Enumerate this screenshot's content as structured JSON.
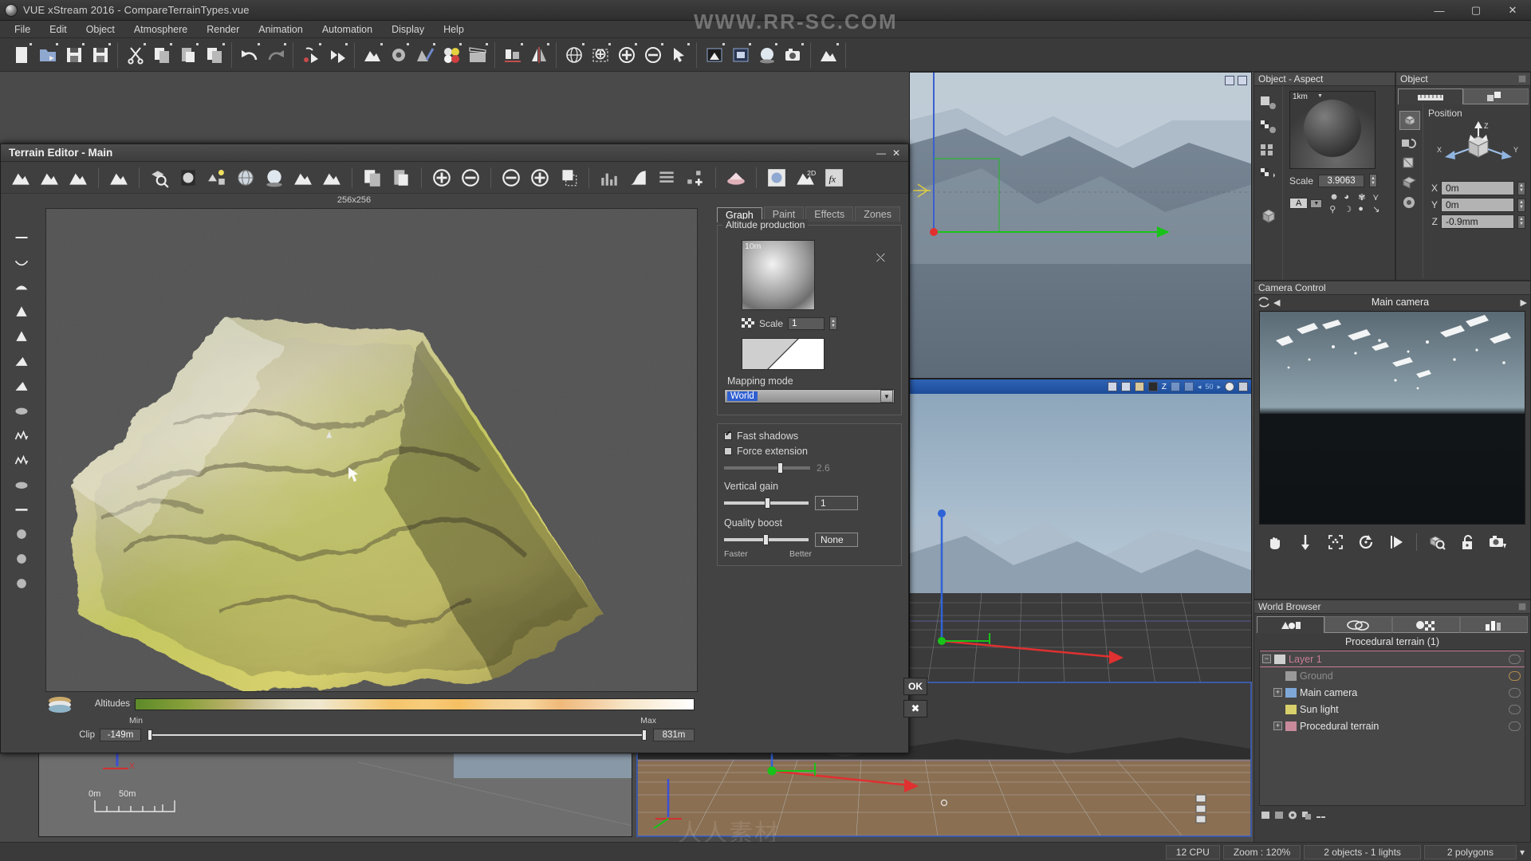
{
  "window": {
    "title": "VUE xStream 2016 - CompareTerrainTypes.vue",
    "minimize": "—",
    "maximize": "▢",
    "close": "✕",
    "logo_icon": "vue-app-icon"
  },
  "menu": [
    "File",
    "Edit",
    "Object",
    "Atmosphere",
    "Render",
    "Animation",
    "Automation",
    "Display",
    "Help"
  ],
  "toolbar": {
    "groups": [
      {
        "name": "file",
        "buttons": [
          {
            "icon": "new-document-icon",
            "label": "New"
          },
          {
            "icon": "open-folder-icon",
            "label": "Open"
          },
          {
            "icon": "save-icon",
            "label": "Save"
          },
          {
            "icon": "quick-save-icon",
            "label": "Quick save"
          }
        ]
      },
      {
        "name": "clipboard",
        "buttons": [
          {
            "icon": "scissors-icon",
            "label": "Cut"
          },
          {
            "icon": "copy-icon",
            "label": "Copy"
          },
          {
            "icon": "paste-icon",
            "label": "Paste"
          },
          {
            "icon": "duplicate-icon",
            "label": "Duplicate"
          }
        ]
      },
      {
        "name": "history",
        "buttons": [
          {
            "icon": "undo-arrow-icon",
            "label": "Undo"
          },
          {
            "icon": "redo-arrow-icon",
            "label": "Redo"
          }
        ]
      },
      {
        "name": "record",
        "buttons": [
          {
            "icon": "record-cursor-icon",
            "label": "Record"
          },
          {
            "icon": "play-cursor-icon",
            "label": "Play"
          }
        ]
      },
      {
        "name": "create",
        "buttons": [
          {
            "icon": "terrain-icon",
            "label": "Create terrain"
          },
          {
            "icon": "object-gear-icon",
            "label": "Object properties"
          },
          {
            "icon": "material-brush-icon",
            "label": "Material editor"
          },
          {
            "icon": "color-spheres-icon",
            "label": "Colors"
          },
          {
            "icon": "clapperboard-icon",
            "label": "Animation"
          }
        ]
      },
      {
        "name": "align",
        "buttons": [
          {
            "icon": "align-bar-icon",
            "label": "Align"
          },
          {
            "icon": "mirror-icon",
            "label": "Mirror"
          }
        ]
      },
      {
        "name": "view",
        "buttons": [
          {
            "icon": "globe-icon",
            "label": "Globe"
          },
          {
            "icon": "zoom-region-icon",
            "label": "Zoom region"
          },
          {
            "icon": "zoom-in-icon",
            "label": "Zoom in"
          },
          {
            "icon": "zoom-out-icon",
            "label": "Zoom out"
          },
          {
            "icon": "select-pointer-icon",
            "label": "Select"
          }
        ]
      },
      {
        "name": "render",
        "buttons": [
          {
            "icon": "render-preview-icon",
            "label": "Render preview"
          },
          {
            "icon": "render-area-icon",
            "label": "Render area"
          },
          {
            "icon": "render-sphere-icon",
            "label": "Render object"
          },
          {
            "icon": "camera-icon",
            "label": "Camera"
          }
        ]
      },
      {
        "name": "export",
        "buttons": [
          {
            "icon": "export-terrain-icon",
            "label": "Export"
          }
        ]
      }
    ]
  },
  "terrain_editor": {
    "title": "Terrain Editor - Main",
    "title_buttons": {
      "minimize": "—",
      "close": "✕"
    },
    "resolution_label": "256x256",
    "toolbar": [
      {
        "icon": "new-terrain-icon",
        "label": "New terrain"
      },
      {
        "icon": "load-terrain-icon",
        "label": "Load terrain"
      },
      {
        "icon": "save-terrain-icon",
        "label": "Save terrain"
      },
      {
        "icon": "terrain-options-icon",
        "label": "Terrain options"
      },
      {
        "icon": "zoom-cube-icon",
        "label": "Zoom"
      },
      {
        "icon": "light-preview-icon",
        "label": "Lighting preview"
      },
      {
        "icon": "scene-preview-icon",
        "label": "Scene preview"
      },
      {
        "icon": "sphere-wire-icon",
        "label": "Wireframe sphere"
      },
      {
        "icon": "sphere-smooth-icon",
        "label": "Smooth sphere"
      },
      {
        "icon": "sphere-terrain-icon",
        "label": "Terrain sphere"
      },
      {
        "icon": "terrain-flat-icon",
        "label": "Flat terrain"
      },
      {
        "icon": "copy-layers-icon",
        "label": "Copy"
      },
      {
        "icon": "paste-layers-icon",
        "label": "Paste"
      },
      {
        "icon": "add-circle-icon",
        "label": "Add"
      },
      {
        "icon": "remove-circle-icon",
        "label": "Remove"
      },
      {
        "icon": "decrease-resolution-icon",
        "label": "Decrease resolution"
      },
      {
        "icon": "increase-resolution-icon",
        "label": "Increase resolution"
      },
      {
        "icon": "crop-icon",
        "label": "Crop"
      },
      {
        "icon": "histogram-icon",
        "label": "Histogram"
      },
      {
        "icon": "curve-icon",
        "label": "Curve"
      },
      {
        "icon": "layers-icon",
        "label": "Layers"
      },
      {
        "icon": "add-node-icon",
        "label": "Add node"
      },
      {
        "icon": "erosion-icon",
        "label": "Erosion"
      },
      {
        "icon": "fullscreen-preview-icon",
        "label": "Fullscreen preview"
      },
      {
        "icon": "terrain-2d-icon",
        "label": "2D view"
      },
      {
        "icon": "effects-fx-icon",
        "label": "Effects"
      }
    ],
    "rail": [
      {
        "icon": "line-tool-icon",
        "label": "Line"
      },
      {
        "icon": "dig-tool-icon",
        "label": "Dig"
      },
      {
        "icon": "raise-tool-icon",
        "label": "Raise"
      },
      {
        "icon": "peak-tool-icon",
        "label": "Peak"
      },
      {
        "icon": "cone-tool-icon",
        "label": "Cone"
      },
      {
        "icon": "ridge-tool-icon",
        "label": "Ridge"
      },
      {
        "icon": "slope-tool-icon",
        "label": "Slope"
      },
      {
        "icon": "smooth-tool-icon",
        "label": "Smooth"
      },
      {
        "icon": "erode-tool-icon",
        "label": "Erode"
      },
      {
        "icon": "noise-tool-icon",
        "label": "Noise"
      },
      {
        "icon": "blur-tool-icon",
        "label": "Blur"
      },
      {
        "icon": "level-tool-icon",
        "label": "Level"
      },
      {
        "icon": "stamp-tool-icon",
        "label": "Stamp"
      },
      {
        "icon": "mask-tool-icon",
        "label": "Mask"
      },
      {
        "icon": "paint-tool-icon",
        "label": "Paint"
      }
    ],
    "tabs": [
      {
        "label": "Graph",
        "active": true
      },
      {
        "label": "Paint",
        "active": false
      },
      {
        "label": "Effects",
        "active": false
      },
      {
        "label": "Zones",
        "active": false
      }
    ],
    "altitude_production": {
      "legend": "Altitude production",
      "preview_caption": "10m",
      "shuffle_icon": "shuffle-icon",
      "scale_icon": "checker-icon",
      "scale_label": "Scale",
      "scale_value": "1",
      "mapping_mode_label": "Mapping mode",
      "mapping_mode_value": "World"
    },
    "shadow_group": {
      "fast_shadows_label": "Fast shadows",
      "fast_shadows_checked": true,
      "force_extension_label": "Force extension",
      "force_extension_checked": false,
      "force_extension_value": "2.6",
      "vertical_gain_label": "Vertical gain",
      "vertical_gain_value": "1",
      "quality_boost_label": "Quality boost",
      "quality_boost_value": "None",
      "faster_label": "Faster",
      "better_label": "Better"
    },
    "altitudes": {
      "label": "Altitudes",
      "clip_label": "Clip",
      "min_label": "Min",
      "max_label": "Max",
      "min_value": "-149m",
      "max_value": "831m",
      "layers_icon": "layers-stack-icon"
    },
    "ok_button": "OK",
    "cancel_button": "✖"
  },
  "object_aspect": {
    "title": "Object - Aspect",
    "preview_caption": "1km",
    "scale_label": "Scale",
    "scale_value": "3.9063",
    "material_letter": "A",
    "left_icons": [
      {
        "icon": "object-material-icon"
      },
      {
        "icon": "checker-material-icon"
      },
      {
        "icon": "multi-material-icon"
      },
      {
        "icon": "material-transfer-icon"
      },
      {
        "icon": "cube-icon"
      }
    ],
    "aspect_icons": [
      {
        "icon": "face-icon"
      },
      {
        "icon": "bump-icon"
      },
      {
        "icon": "plant-icon"
      },
      {
        "icon": "fold-icon"
      },
      {
        "icon": "person-icon"
      },
      {
        "icon": "moon-icon"
      },
      {
        "icon": "sphere-icon"
      },
      {
        "icon": "ruler-icon"
      }
    ]
  },
  "object_panel": {
    "title": "Object",
    "tabs": [
      {
        "icon": "ruler-tab-icon",
        "active": true
      },
      {
        "icon": "objects-tab-icon",
        "active": false
      }
    ],
    "side_icons": [
      {
        "icon": "position-cube-icon",
        "active": true
      },
      {
        "icon": "rotation-icon",
        "active": false
      },
      {
        "icon": "size-icon",
        "active": false
      },
      {
        "icon": "bounding-box-icon",
        "active": false
      },
      {
        "icon": "settings-gear-icon",
        "active": false
      }
    ],
    "position_label": "Position",
    "axis_labels": {
      "x": "X",
      "y": "Y",
      "z": "Z"
    },
    "fields": [
      {
        "axis": "X",
        "value": "0m"
      },
      {
        "axis": "Y",
        "value": "0m"
      },
      {
        "axis": "Z",
        "value": "-0.9mm"
      }
    ]
  },
  "camera_control": {
    "title": "Camera Control",
    "sync_icon": "sync-icon",
    "prev_arrow": "◀",
    "next_arrow": "▶",
    "camera_name": "Main camera",
    "buttons": [
      {
        "icon": "hand-pan-icon",
        "label": "Pan"
      },
      {
        "icon": "move-vertical-icon",
        "label": "Move vertical"
      },
      {
        "icon": "center-target-icon",
        "label": "Center"
      },
      {
        "icon": "orbit-rotate-icon",
        "label": "Orbit"
      },
      {
        "icon": "fly-through-icon",
        "label": "Fly"
      },
      {
        "icon": "zoom-object-icon",
        "label": "Zoom to object"
      },
      {
        "icon": "lock-open-icon",
        "label": "Lock camera"
      },
      {
        "icon": "camera-snapshot-icon",
        "label": "Snapshot"
      }
    ]
  },
  "world_browser": {
    "title": "World Browser",
    "tabs": [
      {
        "icon": "objects-browser-icon",
        "active": true
      },
      {
        "icon": "materials-browser-icon",
        "active": false
      },
      {
        "icon": "texture-browser-icon",
        "active": false
      },
      {
        "icon": "layers-browser-icon",
        "active": false
      }
    ],
    "header": "Procedural terrain (1)",
    "items": [
      {
        "label": "Layer 1",
        "icon": "layer-icon",
        "depth": 0,
        "expander": "−",
        "visible_icon": "eye-icon",
        "selected": true
      },
      {
        "label": "Ground",
        "icon": "ground-icon",
        "depth": 1,
        "expander": "",
        "visible_icon": "lock-icon",
        "selected": false
      },
      {
        "label": "Main camera",
        "icon": "camera-item-icon",
        "depth": 1,
        "expander": "+",
        "visible_icon": "eye-icon",
        "selected": false
      },
      {
        "label": "Sun light",
        "icon": "sun-icon",
        "depth": 1,
        "expander": "",
        "visible_icon": "eye-icon",
        "selected": false
      },
      {
        "label": "Procedural terrain",
        "icon": "terrain-item-icon",
        "depth": 1,
        "expander": "+",
        "visible_icon": "eye-icon",
        "selected": false
      }
    ],
    "footer_icons": [
      {
        "icon": "add-layer-icon"
      },
      {
        "icon": "delete-layer-icon"
      },
      {
        "icon": "layer-settings-icon"
      },
      {
        "icon": "duplicate-layer-icon"
      },
      {
        "icon": "link-layer-icon"
      }
    ]
  },
  "viewports": {
    "top_right_scale": "",
    "bottom_left_scale": {
      "zero": "0m",
      "fifty": "50m"
    },
    "toolbar_icons": [
      {
        "icon": "camera-view-icon"
      },
      {
        "icon": "render-view-icon"
      },
      {
        "icon": "display-mode-icon"
      },
      {
        "icon": "shading-icon"
      },
      {
        "icon": "z-axis-icon"
      },
      {
        "icon": "wireframe-icon"
      },
      {
        "icon": "grid-icon"
      },
      {
        "icon": "zoom-prev-icon"
      },
      {
        "icon": "zoom-next-icon"
      },
      {
        "icon": "quality-icon"
      },
      {
        "icon": "save-view-icon"
      }
    ],
    "zoom_value": "50"
  },
  "statusbar": {
    "cpu": "12 CPU",
    "zoom": "Zoom : 120%",
    "objects": "2 objects - 1 lights",
    "polygons": "2 polygons",
    "dropdown_arrow": "▾"
  },
  "watermarks": [
    "WWW.RR-SC.COM",
    "人人素材"
  ],
  "colors": {
    "accent_blue": "#2f5fd0",
    "window_bg": "#3b3b3b",
    "panel_bg": "#3d3d3d",
    "selection_pink": "#d07a92"
  }
}
